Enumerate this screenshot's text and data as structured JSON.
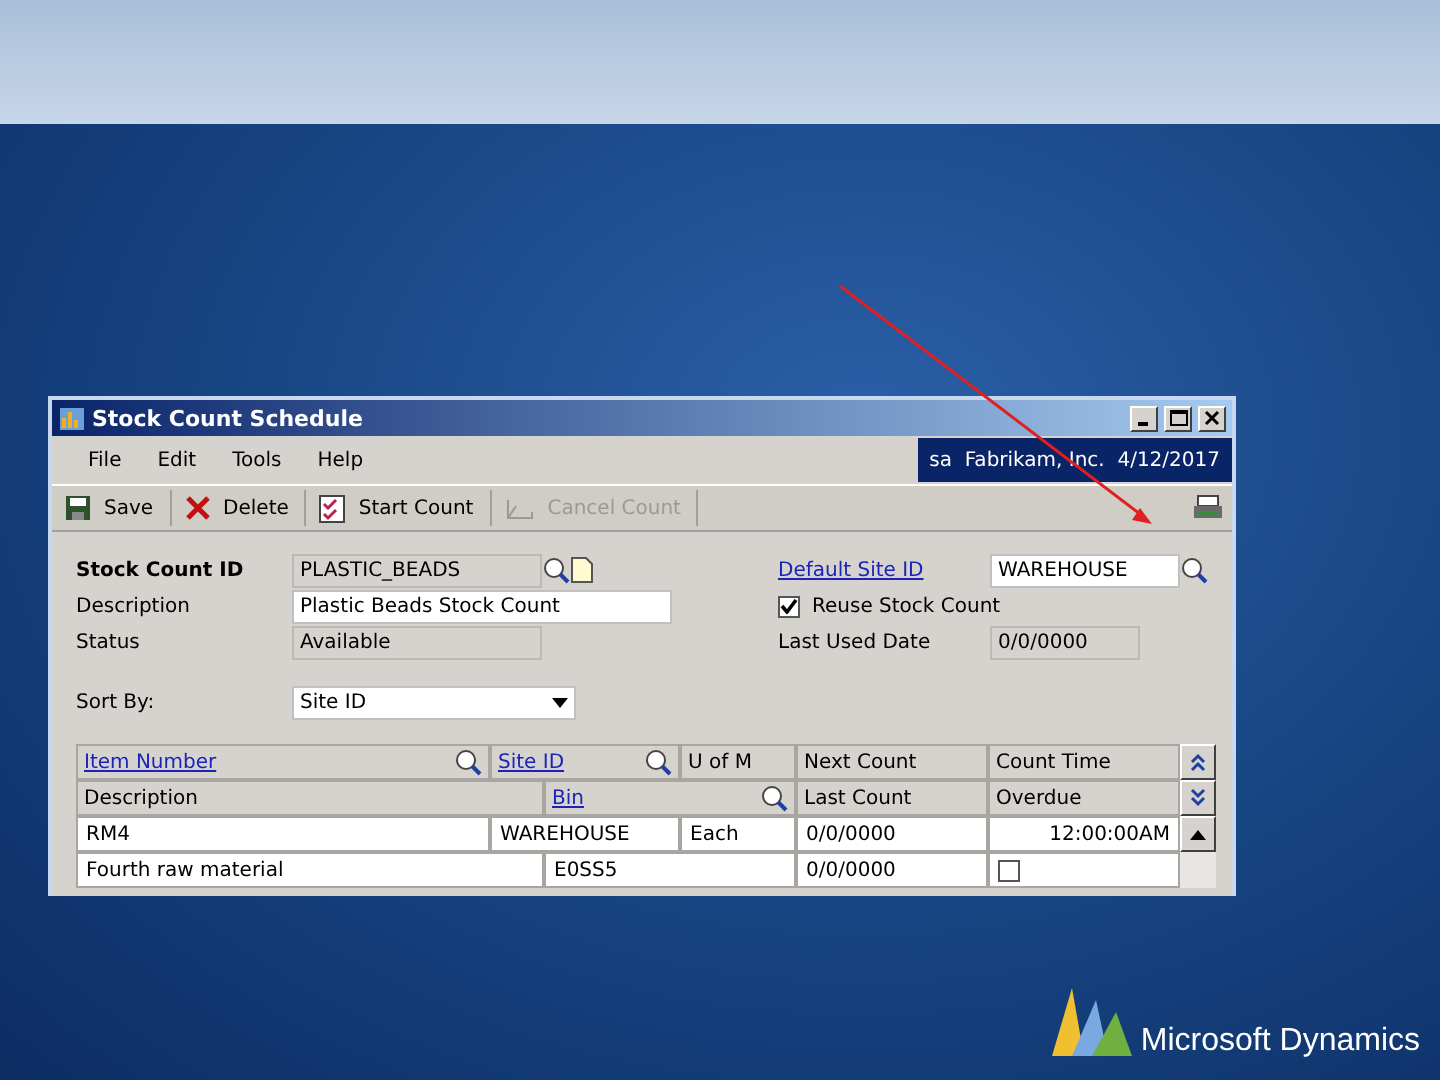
{
  "window": {
    "title": "Stock Count Schedule",
    "menu": [
      "File",
      "Edit",
      "Tools",
      "Help"
    ],
    "company_date": "sa  Fabrikam, Inc.  4/12/2017"
  },
  "toolbar": [
    {
      "kind": "save",
      "label": "Save",
      "disabled": false
    },
    {
      "kind": "delete",
      "label": "Delete",
      "disabled": false
    },
    {
      "kind": "start",
      "label": "Start Count",
      "disabled": false
    },
    {
      "kind": "cancel",
      "label": "Cancel Count",
      "disabled": true
    }
  ],
  "form": {
    "left": [
      {
        "label": "Stock Count ID",
        "value": "PLASTIC_BEADS",
        "kind": "id"
      },
      {
        "label": "Description",
        "value": "Plastic Beads Stock Count",
        "kind": "input"
      },
      {
        "label": "Status",
        "value": "Available",
        "kind": "readonly"
      }
    ],
    "default_site": {
      "label": "Default Site ID",
      "value": "WAREHOUSE"
    },
    "reuse": {
      "label": "Reuse Stock Count",
      "checked": true
    },
    "last_used": {
      "label": "Last Used Date",
      "value": "0/0/0000"
    },
    "sort_by": {
      "label": "Sort By:",
      "value": "Site ID"
    }
  },
  "grid": {
    "header_1": [
      {
        "label": "Item Number",
        "link": true,
        "lookup": true
      },
      {
        "label": "Site ID",
        "link": true,
        "lookup": true
      },
      {
        "label": "U of M",
        "link": false,
        "lookup": false
      },
      {
        "label": "Next Count",
        "link": false,
        "lookup": false
      },
      {
        "label": "Count Time",
        "link": false,
        "lookup": false
      }
    ],
    "header_2": [
      {
        "label": "Description",
        "link": false,
        "lookup": false
      },
      {
        "label": "Bin",
        "link": true,
        "lookup": true
      },
      {
        "label": "Last Count",
        "link": false,
        "lookup": false
      },
      {
        "label": "Overdue",
        "link": false,
        "lookup": false
      }
    ],
    "rows": [
      {
        "item_number": "RM4",
        "site_id": "WAREHOUSE",
        "u_of_m": "Each",
        "next_count": "0/0/0000",
        "count_time": "12:00:00AM",
        "description": "Fourth raw material",
        "bin": "E0SS5",
        "last_count": "0/0/0000",
        "overdue": false
      }
    ]
  },
  "logo": {
    "text": "Microsoft Dynamics"
  }
}
